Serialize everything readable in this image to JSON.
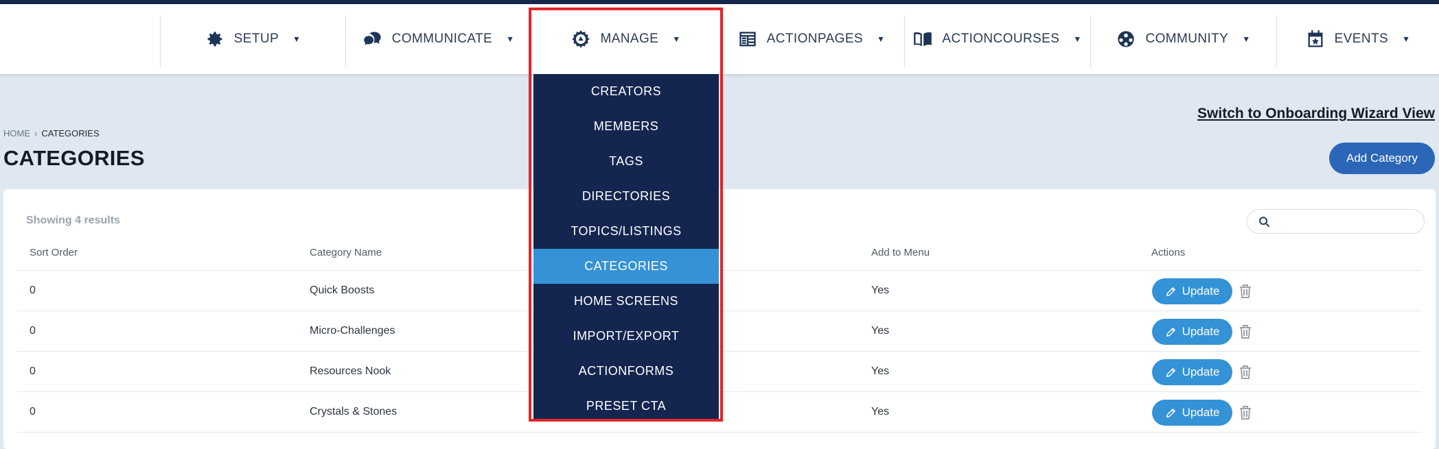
{
  "nav": {
    "items": [
      {
        "label": "SETUP",
        "icon": "gear-icon"
      },
      {
        "label": "COMMUNICATE",
        "icon": "chat-bubbles-icon"
      },
      {
        "label": "MANAGE",
        "icon": "manage-gear-icon"
      },
      {
        "label": "ACTIONPAGES",
        "icon": "page-layout-icon"
      },
      {
        "label": "ACTIONCOURSES",
        "icon": "open-book-icon"
      },
      {
        "label": "COMMUNITY",
        "icon": "community-icon"
      },
      {
        "label": "EVENTS",
        "icon": "calendar-star-icon"
      }
    ]
  },
  "dropdown": {
    "items": [
      "CREATORS",
      "MEMBERS",
      "TAGS",
      "DIRECTORIES",
      "TOPICS/LISTINGS",
      "CATEGORIES",
      "HOME SCREENS",
      "IMPORT/EXPORT",
      "ACTIONFORMS",
      "PRESET CTA"
    ],
    "active": "CATEGORIES"
  },
  "breadcrumb": {
    "home": "HOME",
    "current": "CATEGORIES"
  },
  "page": {
    "title": "CATEGORIES",
    "wizard_link": "Switch to Onboarding Wizard View",
    "add_button": "Add Category"
  },
  "table": {
    "results": "Showing 4 results",
    "headers": [
      "Sort Order",
      "Category Name",
      "Add to Menu",
      "Actions"
    ],
    "update_label": "Update",
    "rows": [
      {
        "sort": "0",
        "name": "Quick Boosts",
        "menu": "Yes"
      },
      {
        "sort": "0",
        "name": "Micro-Challenges",
        "menu": "Yes"
      },
      {
        "sort": "0",
        "name": "Resources Nook",
        "menu": "Yes"
      },
      {
        "sort": "0",
        "name": "Crystals & Stones",
        "menu": "Yes"
      }
    ]
  },
  "colors": {
    "brand_dark": "#14264f",
    "accent": "#3592d4",
    "button": "#2b66b8",
    "highlight": "#e0262a"
  }
}
